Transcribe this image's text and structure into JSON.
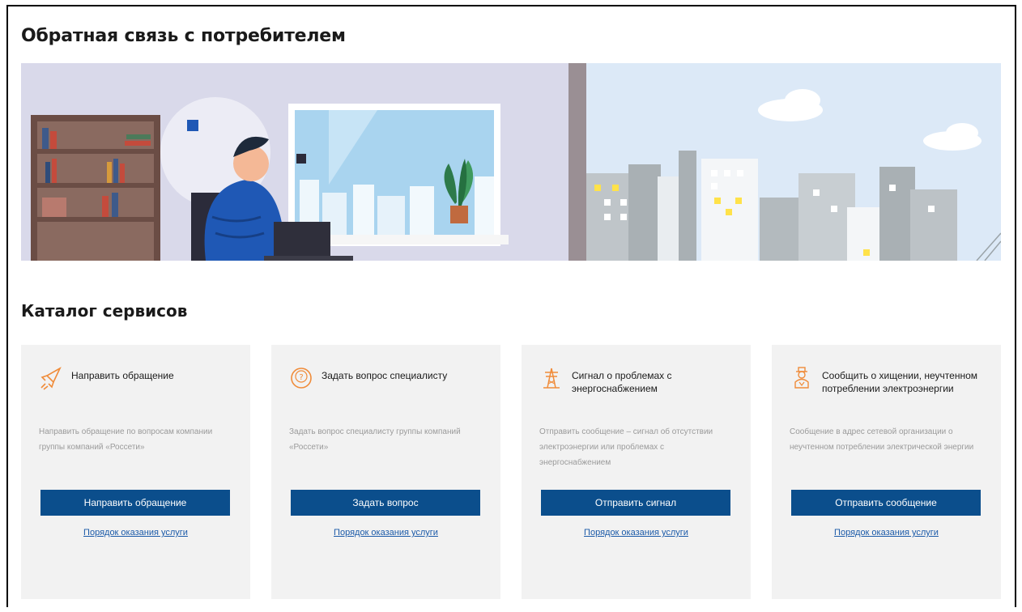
{
  "page": {
    "title": "Обратная связь с потребителем",
    "catalog_title": "Каталог сервисов"
  },
  "colors": {
    "accent": "#0b4e8c",
    "icon_orange": "#f08c3a",
    "card_bg": "#f2f2f2",
    "link": "#1b5aa8"
  },
  "cards": [
    {
      "icon": "rocket-icon",
      "title": "Направить обращение",
      "description": "Направить обращение по вопросам компании группы компаний «Россети»",
      "button": "Направить обращение",
      "link": "Порядок оказания услуги"
    },
    {
      "icon": "question-circle-icon",
      "title": "Задать вопрос специалисту",
      "description": "Задать вопрос специалисту группы компаний «Россети»",
      "button": "Задать вопрос",
      "link": "Порядок оказания услуги"
    },
    {
      "icon": "power-tower-icon",
      "title": "Сигнал о проблемах с энергоснабжением",
      "description": "Отправить сообщение – сигнал об отсутствии электроэнергии или проблемах с энергоснабжением",
      "button": "Отправить сигнал",
      "link": "Порядок оказания услуги"
    },
    {
      "icon": "thief-icon",
      "title": "Сообщить о хищении, неучтенном потреблении электроэнергии",
      "description": "Сообщение в адрес сетевой организации о неучтенном потреблении электрической энергии",
      "button": "Отправить сообщение",
      "link": "Порядок оказания услуги"
    }
  ]
}
